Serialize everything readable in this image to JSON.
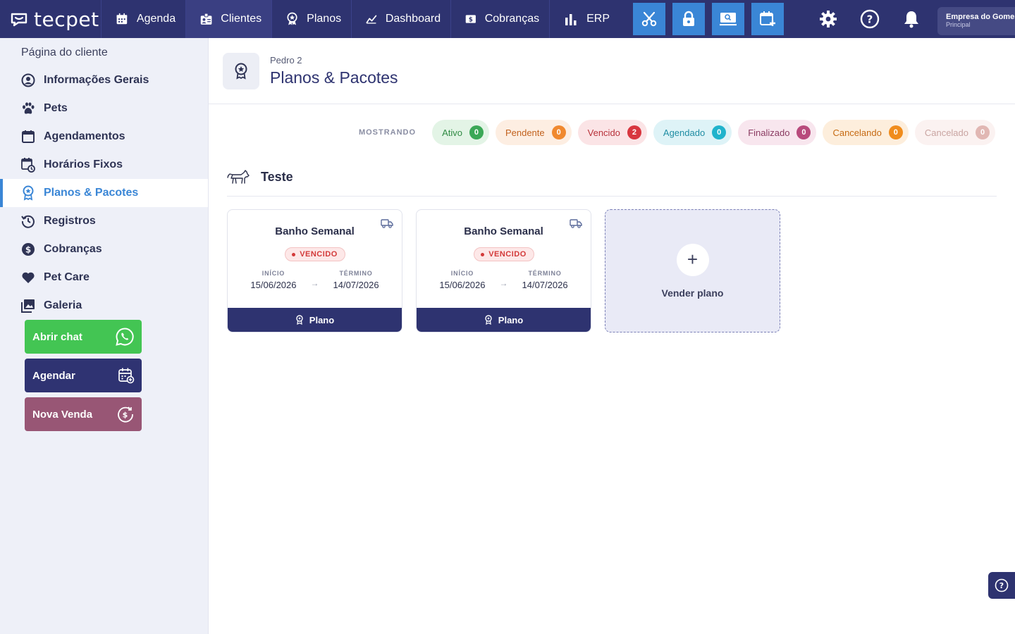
{
  "brand": {
    "name": "tecpet"
  },
  "nav": {
    "items": [
      {
        "label": "Agenda",
        "icon": "calendar-icon"
      },
      {
        "label": "Clientes",
        "icon": "clients-icon"
      },
      {
        "label": "Planos",
        "icon": "award-icon"
      },
      {
        "label": "Dashboard",
        "icon": "chart-line-icon"
      },
      {
        "label": "Cobranças",
        "icon": "dollar-icon"
      },
      {
        "label": "ERP",
        "icon": "bar-chart-icon"
      }
    ],
    "active": "Clientes"
  },
  "company": {
    "name": "Empresa do Gomes",
    "subtitle": "Principal"
  },
  "sidebar": {
    "title": "Página do cliente",
    "items": [
      {
        "label": "Informações Gerais"
      },
      {
        "label": "Pets"
      },
      {
        "label": "Agendamentos"
      },
      {
        "label": "Horários Fixos"
      },
      {
        "label": "Planos & Pacotes"
      },
      {
        "label": "Registros"
      },
      {
        "label": "Cobranças"
      },
      {
        "label": "Pet Care"
      },
      {
        "label": "Galeria"
      }
    ],
    "active_index": 4,
    "actions": {
      "chat": "Abrir chat",
      "schedule": "Agendar",
      "sale": "Nova Venda"
    }
  },
  "header": {
    "client": "Pedro 2",
    "title": "Planos & Pacotes"
  },
  "filters": {
    "label": "MOSTRANDO",
    "pills": [
      {
        "label": "Ativo",
        "count": "0",
        "bg": "#e3f4e6",
        "fg": "#2f8a43",
        "badge": "#3aa856"
      },
      {
        "label": "Pendente",
        "count": "0",
        "bg": "#fdeee2",
        "fg": "#c2611d",
        "badge": "#f0892f"
      },
      {
        "label": "Vencido",
        "count": "2",
        "bg": "#fbe4e6",
        "fg": "#b8313a",
        "badge": "#d8363f"
      },
      {
        "label": "Agendado",
        "count": "0",
        "bg": "#def3f7",
        "fg": "#1f8da3",
        "badge": "#20b3cc"
      },
      {
        "label": "Finalizado",
        "count": "0",
        "bg": "#f8e6ee",
        "fg": "#8a3a61",
        "badge": "#b84a7c"
      },
      {
        "label": "Cancelando",
        "count": "0",
        "bg": "#fdeedc",
        "fg": "#c66a12",
        "badge": "#f08c1c"
      },
      {
        "label": "Cancelado",
        "count": "0",
        "bg": "#fbf2f1",
        "fg": "#c9a4a1",
        "badge": "#e1b7b3"
      }
    ]
  },
  "pet": {
    "name": "Teste"
  },
  "plans": [
    {
      "title": "Banho Semanal",
      "status": "VENCIDO",
      "start_label": "INÍCIO",
      "start": "15/06/2026",
      "end_label": "TÉRMINO",
      "end": "14/07/2026",
      "footer": "Plano"
    },
    {
      "title": "Banho Semanal",
      "status": "VENCIDO",
      "start_label": "INÍCIO",
      "start": "15/06/2026",
      "end_label": "TÉRMINO",
      "end": "14/07/2026",
      "footer": "Plano"
    }
  ],
  "add_plan": {
    "label": "Vender plano"
  }
}
